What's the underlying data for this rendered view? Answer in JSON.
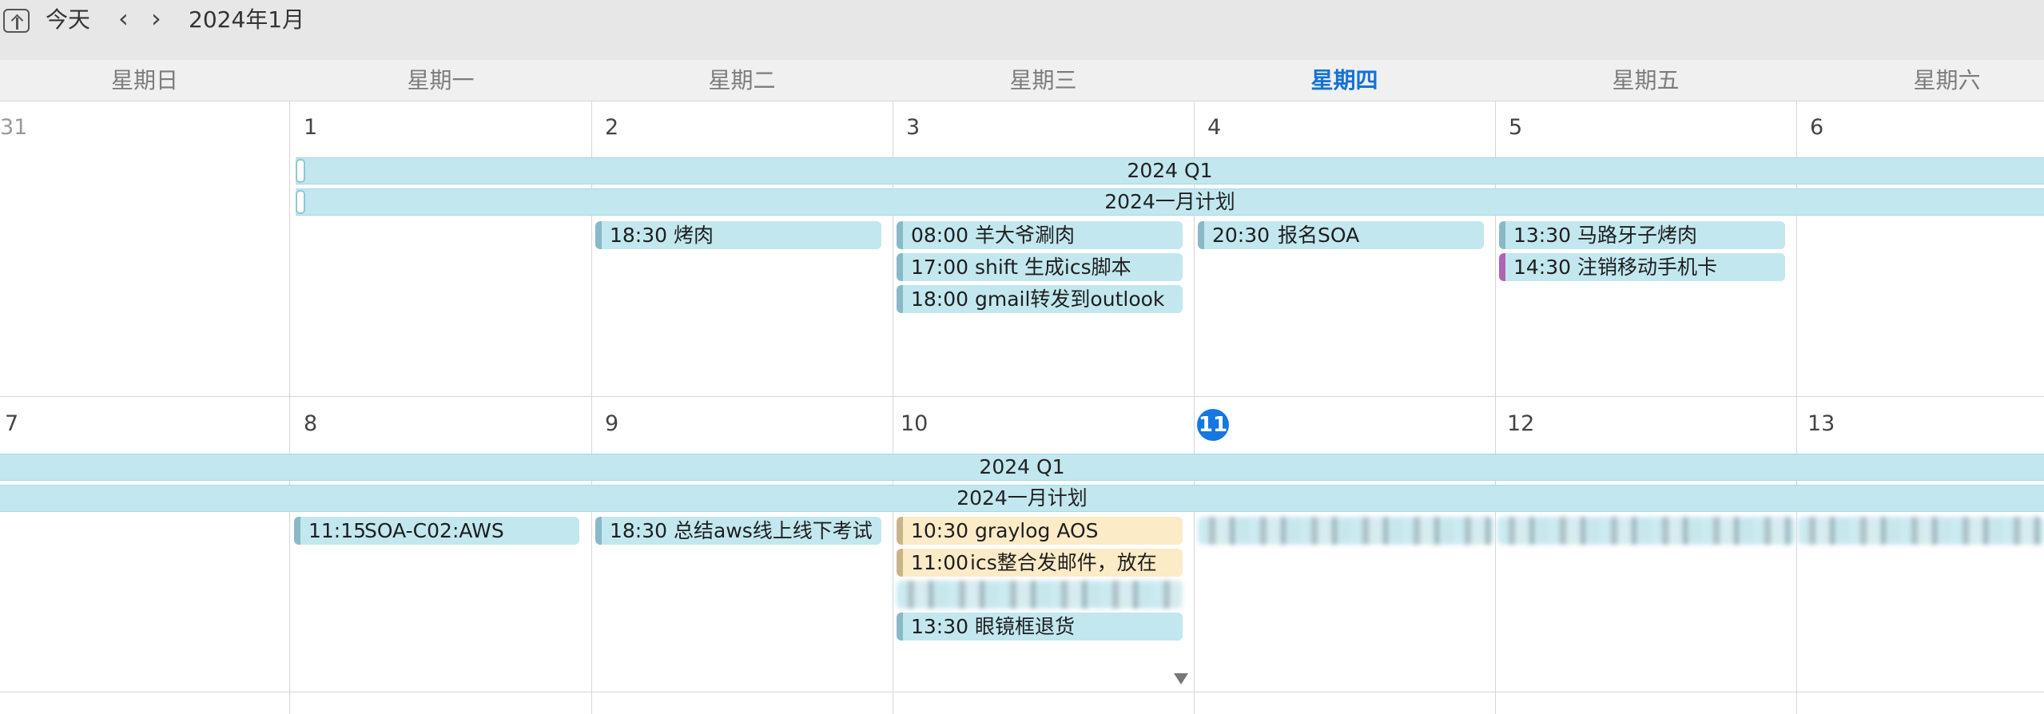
{
  "toolbar": {
    "today_label": "今天",
    "prev": "‹",
    "next": "›",
    "month_title": "2024年1月"
  },
  "weekdays": [
    "星期日",
    "星期一",
    "星期二",
    "星期三",
    "星期四",
    "星期五",
    "星期六"
  ],
  "week1": {
    "days": [
      "31",
      "1",
      "2",
      "3",
      "4",
      "5",
      "6"
    ]
  },
  "week2": {
    "days": [
      "7",
      "8",
      "9",
      "10",
      "11",
      "12",
      "13"
    ]
  },
  "allday": {
    "q1": "2024 Q1",
    "jan_plan": "2024一月计划"
  },
  "events": {
    "w1_tue": {
      "time": "18:30",
      "title": "烤肉"
    },
    "w1_wed1": {
      "time": "08:00",
      "title": "羊大爷涮肉"
    },
    "w1_wed2": {
      "time": "17:00",
      "title": "shift 生成ics脚本"
    },
    "w1_wed3": {
      "time": "18:00",
      "title": "gmail转发到outlook"
    },
    "w1_thu": {
      "time": "20:30",
      "title": "报名SOA"
    },
    "w1_fri1": {
      "time": "13:30",
      "title": "马路牙子烤肉"
    },
    "w1_fri2": {
      "time": "14:30",
      "title": "注销移动手机卡"
    },
    "w2_mon": {
      "time": "11:15",
      "title": "SOA-C02:AWS"
    },
    "w2_tue": {
      "time": "18:30",
      "title": "总结aws线上线下考试"
    },
    "w2_wed1": {
      "time": "10:30",
      "title": "graylog AOS"
    },
    "w2_wed2": {
      "time": "11:00",
      "title": "ics整合发邮件，放在"
    },
    "w2_wed4": {
      "time": "13:30",
      "title": "眼镜框退货"
    }
  },
  "colors": {
    "event_bg": "#c2e7ef",
    "today_blue": "#1677e0",
    "yellow_event": "#fcebc7",
    "purple_stripe": "#b163b4"
  }
}
